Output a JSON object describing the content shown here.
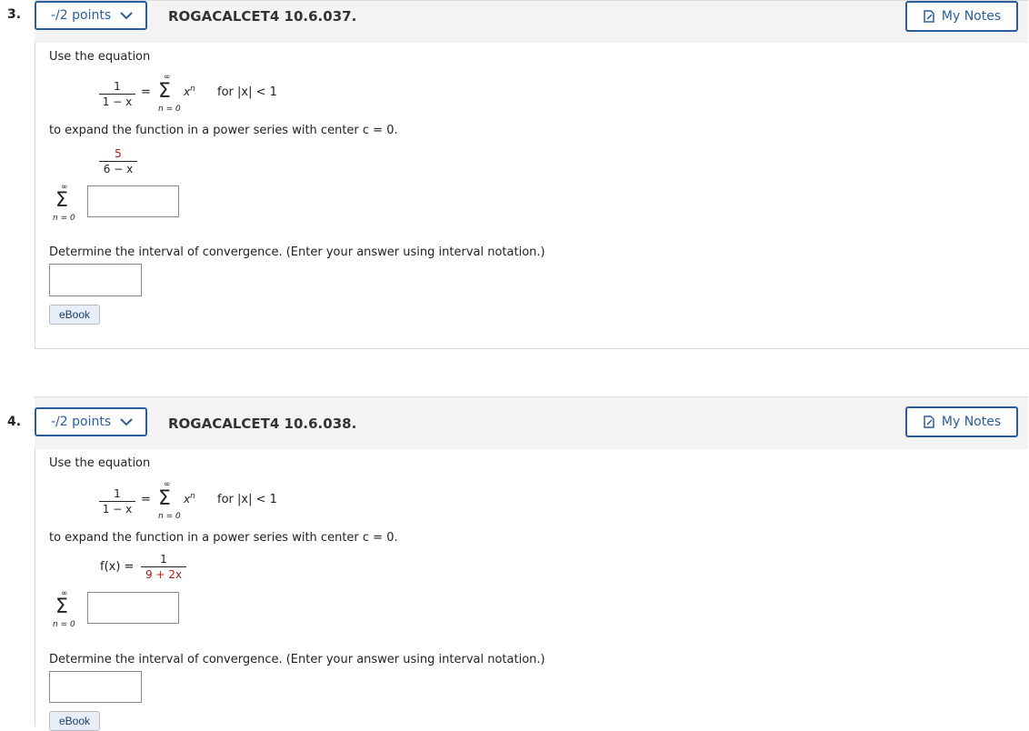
{
  "questions": [
    {
      "number": "3.",
      "points": "-/2 points",
      "code": "ROGACALCET4 10.6.037.",
      "my_notes": "My Notes",
      "intro": "Use the equation",
      "eq_num": "1",
      "eq_den": "1 − x",
      "eq_equals": "=",
      "eq_sigma": "Σ",
      "eq_inf": "∞",
      "eq_term": "x",
      "eq_term_sup": "n",
      "eq_lower": "n = 0",
      "eq_cond": "for |x| < 1",
      "expand_text": "to expand the function in a power series with center c = 0.",
      "func_prefix": "",
      "func_num": "5",
      "func_den": "6 − x",
      "answer_sigma": "Σ",
      "answer_inf": "∞",
      "answer_lower": "n = 0",
      "series_answer": "",
      "convergence_prompt": "Determine the interval of convergence. (Enter your answer using interval notation.)",
      "interval_answer": "",
      "ebook": "eBook"
    },
    {
      "number": "4.",
      "points": "-/2 points",
      "code": "ROGACALCET4 10.6.038.",
      "my_notes": "My Notes",
      "intro": "Use the equation",
      "eq_num": "1",
      "eq_den": "1 − x",
      "eq_equals": "=",
      "eq_sigma": "Σ",
      "eq_inf": "∞",
      "eq_term": "x",
      "eq_term_sup": "n",
      "eq_lower": "n = 0",
      "eq_cond": "for |x| < 1",
      "expand_text": "to expand the function in a power series with center c = 0.",
      "func_prefix": "f(x) =",
      "func_num": "1",
      "func_den": "9 + 2x",
      "answer_sigma": "Σ",
      "answer_inf": "∞",
      "answer_lower": "n = 0",
      "series_answer": "",
      "convergence_prompt": "Determine the interval of convergence. (Enter your answer using interval notation.)",
      "interval_answer": "",
      "ebook": "eBook"
    }
  ],
  "colors": {
    "accent": "#2a5d9f",
    "highlight": "#c01818",
    "header_bg": "#f3f3f3"
  }
}
